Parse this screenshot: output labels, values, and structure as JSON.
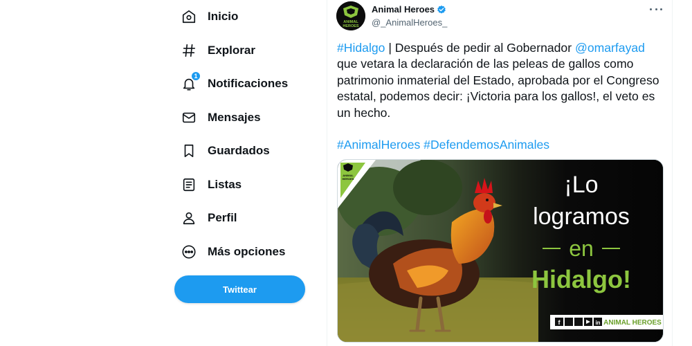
{
  "nav": {
    "items": [
      {
        "label": "Inicio",
        "icon": "home-icon"
      },
      {
        "label": "Explorar",
        "icon": "hashtag-icon"
      },
      {
        "label": "Notificaciones",
        "icon": "bell-icon",
        "badge": "1"
      },
      {
        "label": "Mensajes",
        "icon": "envelope-icon"
      },
      {
        "label": "Guardados",
        "icon": "bookmark-icon"
      },
      {
        "label": "Listas",
        "icon": "list-icon"
      },
      {
        "label": "Perfil",
        "icon": "person-icon"
      },
      {
        "label": "Más opciones",
        "icon": "more-circle-icon"
      }
    ],
    "tweet_button": "Twittear"
  },
  "tweet": {
    "display_name": "Animal Heroes",
    "handle": "@_AnimalHeroes_",
    "avatar_text": [
      "ANIMAL",
      "HEROES"
    ],
    "text": {
      "hashtag1": "#Hidalgo",
      "part1": " | Después de pedir al Gobernador ",
      "mention": "@omarfayad",
      "part2": " que vetara la declaración de las peleas de gallos como patrimonio inmaterial del Estado, aprobada por el Congreso estatal, podemos decir: ¡Victoria para los gallos!, el veto es un hecho.",
      "hashtag2": "#AnimalHeroes",
      "hashtag3": "#DefendemosAnimales"
    },
    "media": {
      "headline": [
        "¡Lo",
        "logramos",
        "en",
        "Hidalgo!"
      ],
      "footer_brand": "ANIMAL HEROES",
      "logo_text": [
        "ANIMAL",
        "HEROES"
      ],
      "social_icons": [
        "facebook-icon",
        "twitter-icon",
        "instagram-icon",
        "youtube-icon",
        "linkedin-icon"
      ]
    }
  },
  "colors": {
    "accent": "#1d9bf0",
    "text": "#0f1419",
    "muted": "#536471",
    "brand_green": "#8dc63f"
  }
}
